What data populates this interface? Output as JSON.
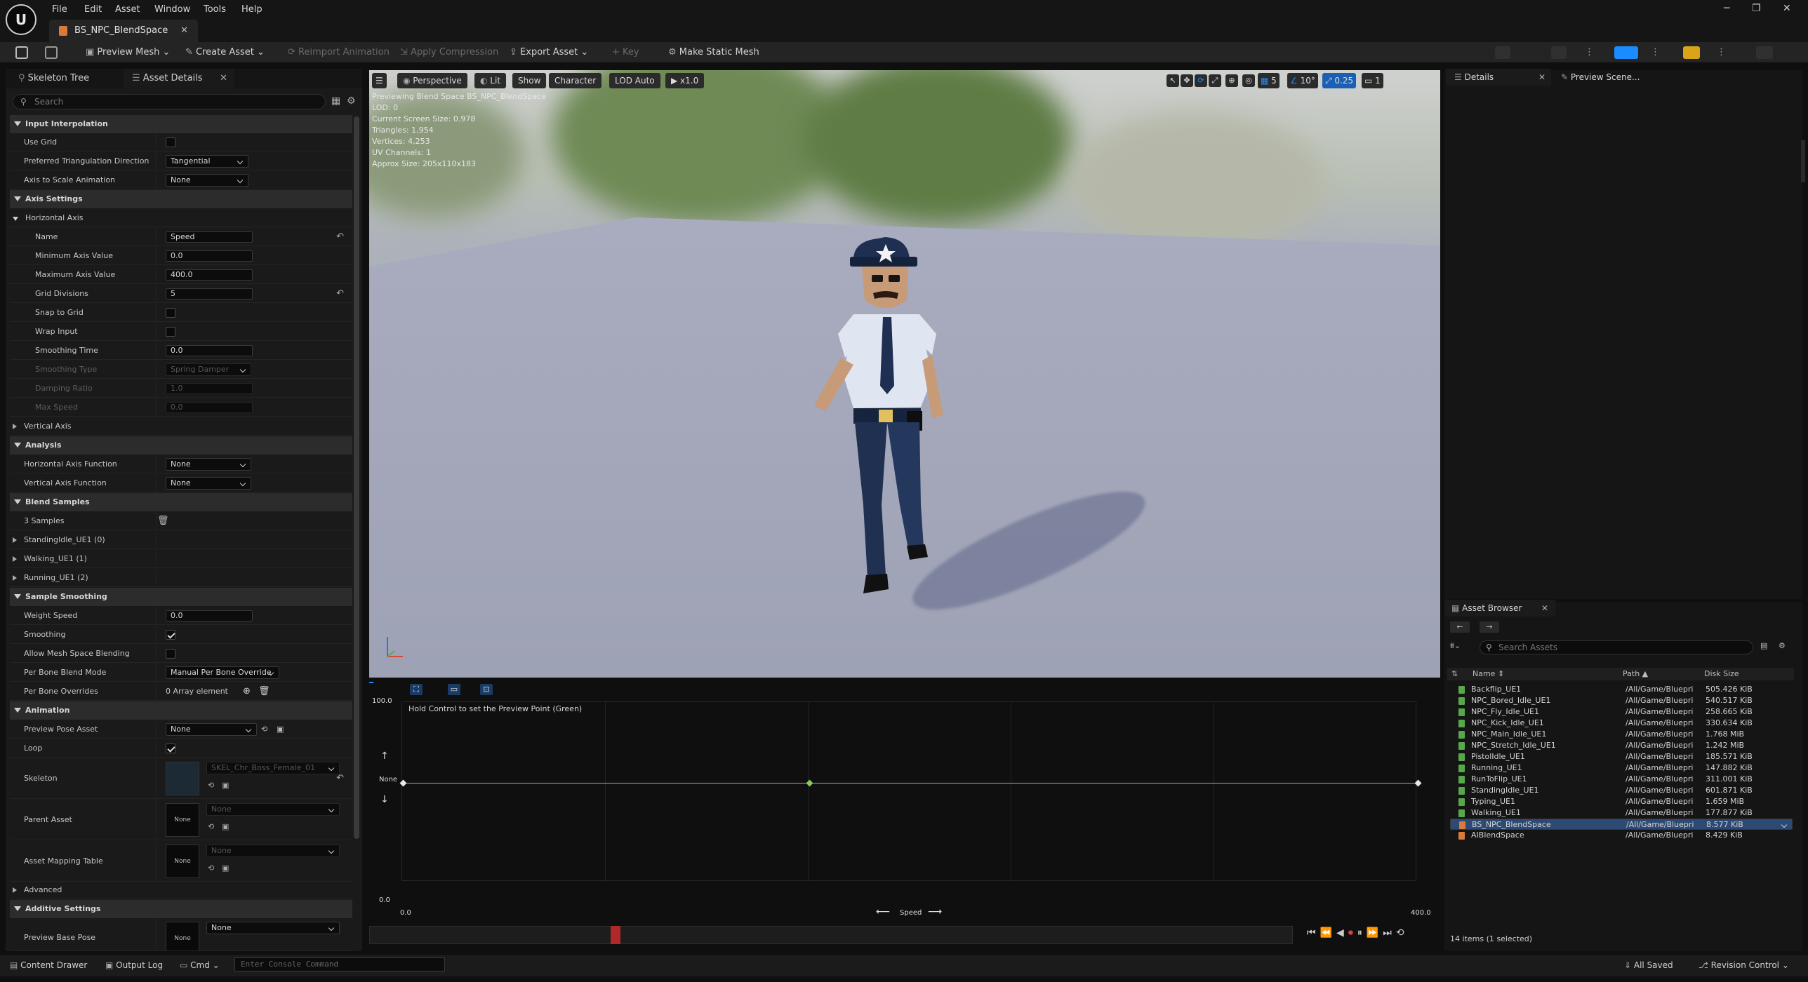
{
  "menu": [
    "File",
    "Edit",
    "Asset",
    "Window",
    "Tools",
    "Help"
  ],
  "doc_tab": "BS_NPC_BlendSpace",
  "toolbar": {
    "preview_mesh": "Preview Mesh",
    "create_asset": "Create Asset",
    "reimport": "Reimport Animation",
    "apply_compression": "Apply Compression",
    "export_asset": "Export Asset",
    "key": "Key",
    "make_static_mesh": "Make Static Mesh"
  },
  "left_tabs": {
    "skeleton_tree": "Skeleton Tree",
    "asset_details": "Asset Details"
  },
  "search_placeholder": "Search",
  "props": {
    "input_interpolation": "Input Interpolation",
    "use_grid": "Use Grid",
    "pref_triangulation": "Preferred Triangulation Direction",
    "pref_triangulation_val": "Tangential",
    "axis_to_scale": "Axis to Scale Animation",
    "axis_to_scale_val": "None",
    "axis_settings": "Axis Settings",
    "horizontal_axis": "Horizontal Axis",
    "name": "Name",
    "name_val": "Speed",
    "min_axis": "Minimum Axis Value",
    "min_axis_val": "0.0",
    "max_axis": "Maximum Axis Value",
    "max_axis_val": "400.0",
    "grid_divisions": "Grid Divisions",
    "grid_divisions_val": "5",
    "snap_to_grid": "Snap to Grid",
    "wrap_input": "Wrap Input",
    "smoothing_time": "Smoothing Time",
    "smoothing_time_val": "0.0",
    "smoothing_type": "Smoothing Type",
    "smoothing_type_val": "Spring Damper",
    "damping_ratio": "Damping Ratio",
    "damping_ratio_val": "1.0",
    "max_speed": "Max Speed",
    "max_speed_val": "0.0",
    "vertical_axis": "Vertical Axis",
    "analysis": "Analysis",
    "h_axis_func": "Horizontal Axis Function",
    "h_axis_func_val": "None",
    "v_axis_func": "Vertical Axis Function",
    "v_axis_func_val": "None",
    "blend_samples": "Blend Samples",
    "samples_count": "3 Samples",
    "sample_1": "StandingIdle_UE1 (0)",
    "sample_2": "Walking_UE1 (1)",
    "sample_3": "Running_UE1 (2)",
    "sample_smoothing": "Sample Smoothing",
    "weight_speed": "Weight Speed",
    "weight_speed_val": "0.0",
    "smoothing": "Smoothing",
    "allow_mesh_blend": "Allow Mesh Space Blending",
    "per_bone_mode": "Per Bone Blend Mode",
    "per_bone_mode_val": "Manual Per Bone Override",
    "per_bone_overrides": "Per Bone Overrides",
    "per_bone_overrides_val": "0 Array element",
    "animation": "Animation",
    "preview_pose": "Preview Pose Asset",
    "preview_pose_val": "None",
    "loop": "Loop",
    "skeleton": "Skeleton",
    "skeleton_val": "SKEL_Chr_Boss_Female_01",
    "parent_asset": "Parent Asset",
    "parent_asset_val": "None",
    "none_thumb": "None",
    "asset_mapping": "Asset Mapping Table",
    "asset_mapping_val": "None",
    "advanced": "Advanced",
    "additive_settings": "Additive Settings",
    "preview_base_pose": "Preview Base Pose",
    "preview_base_pose_val": "None"
  },
  "viewport": {
    "perspective": "Perspective",
    "lit": "Lit",
    "show": "Show",
    "character": "Character",
    "lod": "LOD Auto",
    "speed": "x1.0",
    "grid_snap": "5",
    "rot_snap": "10°",
    "scale_snap": "0.25",
    "cam_count": "1",
    "info": [
      "Previewing Blend Space BS_NPC_BlendSpace",
      "LOD: 0",
      "Current Screen Size: 0.978",
      "Triangles: 1,954",
      "Vertices: 4,253",
      "UV Channels: 1",
      "Approx Size: 205x110x183"
    ]
  },
  "blendspace": {
    "y_max": "100.0",
    "y_min": "0.0",
    "y_none": "None",
    "hint": "Hold Control to set the Preview Point (Green)",
    "x_min": "0.0",
    "x_max": "400.0",
    "x_label": "Speed"
  },
  "details_tab": "Details",
  "preview_scene_tab": "Preview Scene...",
  "asset_browser": {
    "tab": "Asset Browser",
    "search_placeholder": "Search Assets",
    "col_name": "Name",
    "col_path": "Path",
    "col_size": "Disk Size",
    "rows": [
      {
        "name": "Backflip_UE1",
        "path": "/All/Game/Bluepri",
        "size": "505.426 KiB",
        "type": "anim"
      },
      {
        "name": "NPC_Bored_Idle_UE1",
        "path": "/All/Game/Bluepri",
        "size": "540.517 KiB",
        "type": "anim"
      },
      {
        "name": "NPC_Fly_Idle_UE1",
        "path": "/All/Game/Bluepri",
        "size": "258.665 KiB",
        "type": "anim"
      },
      {
        "name": "NPC_Kick_Idle_UE1",
        "path": "/All/Game/Bluepri",
        "size": "330.634 KiB",
        "type": "anim"
      },
      {
        "name": "NPC_Main_Idle_UE1",
        "path": "/All/Game/Bluepri",
        "size": "1.768 MiB",
        "type": "anim"
      },
      {
        "name": "NPC_Stretch_Idle_UE1",
        "path": "/All/Game/Bluepri",
        "size": "1.242 MiB",
        "type": "anim"
      },
      {
        "name": "PistolIdle_UE1",
        "path": "/All/Game/Bluepri",
        "size": "185.571 KiB",
        "type": "anim"
      },
      {
        "name": "Running_UE1",
        "path": "/All/Game/Bluepri",
        "size": "147.882 KiB",
        "type": "anim"
      },
      {
        "name": "RunToFlip_UE1",
        "path": "/All/Game/Bluepri",
        "size": "311.001 KiB",
        "type": "anim"
      },
      {
        "name": "StandingIdle_UE1",
        "path": "/All/Game/Bluepri",
        "size": "601.871 KiB",
        "type": "anim"
      },
      {
        "name": "Typing_UE1",
        "path": "/All/Game/Bluepri",
        "size": "1.659 MiB",
        "type": "anim"
      },
      {
        "name": "Walking_UE1",
        "path": "/All/Game/Bluepri",
        "size": "177.877 KiB",
        "type": "anim"
      },
      {
        "name": "BS_NPC_BlendSpace",
        "path": "/All/Game/Bluepri",
        "size": "8.577 KiB",
        "type": "blendspace",
        "selected": true
      },
      {
        "name": "AIBlendSpace",
        "path": "/All/Game/Bluepri",
        "size": "8.429 KiB",
        "type": "blendspace"
      }
    ],
    "footer": "14 items (1 selected)"
  },
  "status": {
    "content_drawer": "Content Drawer",
    "output_log": "Output Log",
    "cmd": "Cmd",
    "console_placeholder": "Enter Console Command",
    "all_saved": "All Saved",
    "revision_control": "Revision Control"
  },
  "colors": {
    "accent": "#1a8cff",
    "selected_row": "#2d4a74",
    "scrub": "#b02828"
  }
}
